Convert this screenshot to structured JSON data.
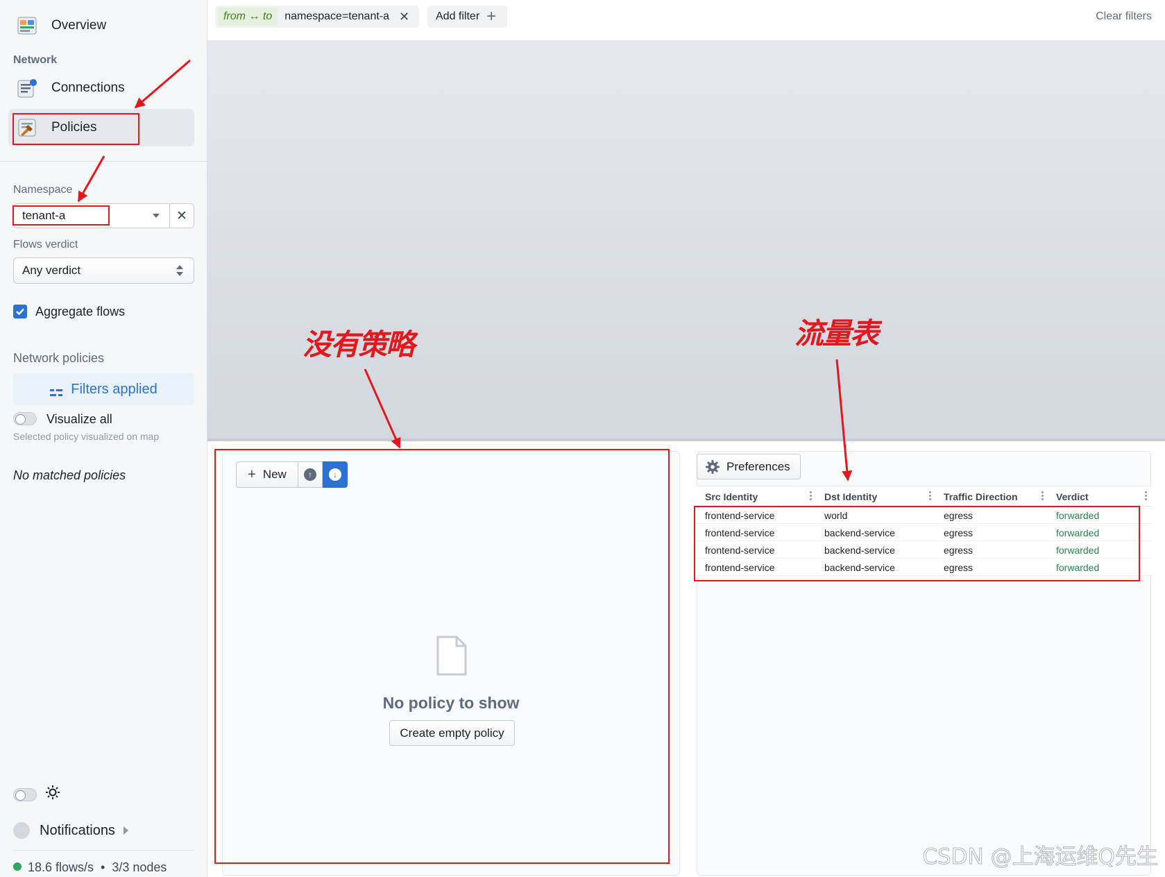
{
  "sidebar": {
    "nav": {
      "overview": "Overview",
      "section_network": "Network",
      "connections": "Connections",
      "policies": "Policies"
    },
    "namespace": {
      "label": "Namespace",
      "value": "tenant-a"
    },
    "flows_verdict": {
      "label": "Flows verdict",
      "value": "Any verdict"
    },
    "aggregate_flows": {
      "label": "Aggregate flows",
      "checked": true
    },
    "network_policies": {
      "label": "Network policies",
      "filters_button": "Filters applied",
      "visualize_all": "Visualize all",
      "hint": "Selected policy visualized on map",
      "empty": "No matched policies"
    },
    "footer": {
      "notifications": "Notifications",
      "flows_rate": "18.6 flows/s",
      "separator": "•",
      "nodes": "3/3 nodes"
    }
  },
  "topbar": {
    "filter_direction": "from ↔ to",
    "filter_value": "namespace=tenant-a",
    "add_filter": "Add filter",
    "clear_filters": "Clear filters"
  },
  "policy_panel": {
    "new_button": "New",
    "empty_title": "No policy to show",
    "create_button": "Create empty policy"
  },
  "flows_panel": {
    "preferences_button": "Preferences",
    "columns": [
      "Src Identity",
      "Dst Identity",
      "Traffic Direction",
      "Verdict"
    ],
    "rows": [
      [
        "frontend-service",
        "world",
        "egress",
        "forwarded"
      ],
      [
        "frontend-service",
        "backend-service",
        "egress",
        "forwarded"
      ],
      [
        "frontend-service",
        "backend-service",
        "egress",
        "forwarded"
      ],
      [
        "frontend-service",
        "backend-service",
        "egress",
        "forwarded"
      ]
    ]
  },
  "annotations": {
    "no_policy": "没有策略",
    "flow_table": "流量表"
  },
  "watermark": "CSDN @上海运维Q先生",
  "colors": {
    "accent": "#2d72d2",
    "annotation_red": "#e4171d",
    "forwarded_green": "#238551",
    "status_green": "#32a467"
  }
}
